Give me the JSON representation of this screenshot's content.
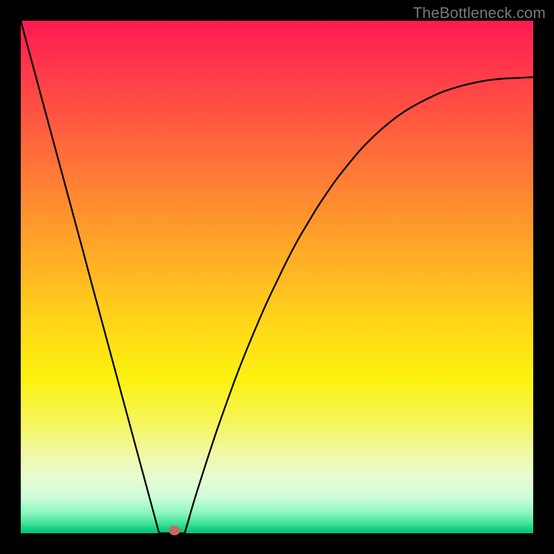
{
  "attribution": "TheBottleneck.com",
  "colors": {
    "background": "#000000",
    "curve_stroke": "#000000",
    "minpoint_fill": "#c96a5c",
    "attribution_text": "#7a7a7a"
  },
  "chart_data": {
    "type": "line",
    "title": "",
    "xlabel": "",
    "ylabel": "",
    "xlim": [
      0,
      100
    ],
    "ylim": [
      0,
      100
    ],
    "x": [
      0,
      2,
      4,
      6,
      8,
      10,
      12,
      14,
      16,
      18,
      20,
      22,
      24,
      26,
      27,
      32,
      33,
      34,
      36,
      38,
      40,
      42,
      44,
      46,
      48,
      50,
      52,
      54,
      56,
      58,
      60,
      62,
      64,
      66,
      68,
      70,
      72,
      74,
      76,
      78,
      80,
      82,
      84,
      86,
      88,
      90,
      92,
      94,
      96,
      98,
      100
    ],
    "values": [
      100,
      92.6,
      85.2,
      77.8,
      70.4,
      63.0,
      55.6,
      48.1,
      40.7,
      33.3,
      25.9,
      18.5,
      11.1,
      3.7,
      0.0,
      0.0,
      3.5,
      6.9,
      13.2,
      19.3,
      25.0,
      30.5,
      35.6,
      40.4,
      45.0,
      49.2,
      53.3,
      57.1,
      60.5,
      63.8,
      66.8,
      69.6,
      72.1,
      74.5,
      76.6,
      78.5,
      80.2,
      81.7,
      83.0,
      84.1,
      85.1,
      86.0,
      86.7,
      87.3,
      87.8,
      88.2,
      88.5,
      88.7,
      88.8,
      88.9,
      89.0
    ],
    "minimum": {
      "x_fraction": 0.3,
      "y_fraction": 0.0
    },
    "annotations": []
  }
}
